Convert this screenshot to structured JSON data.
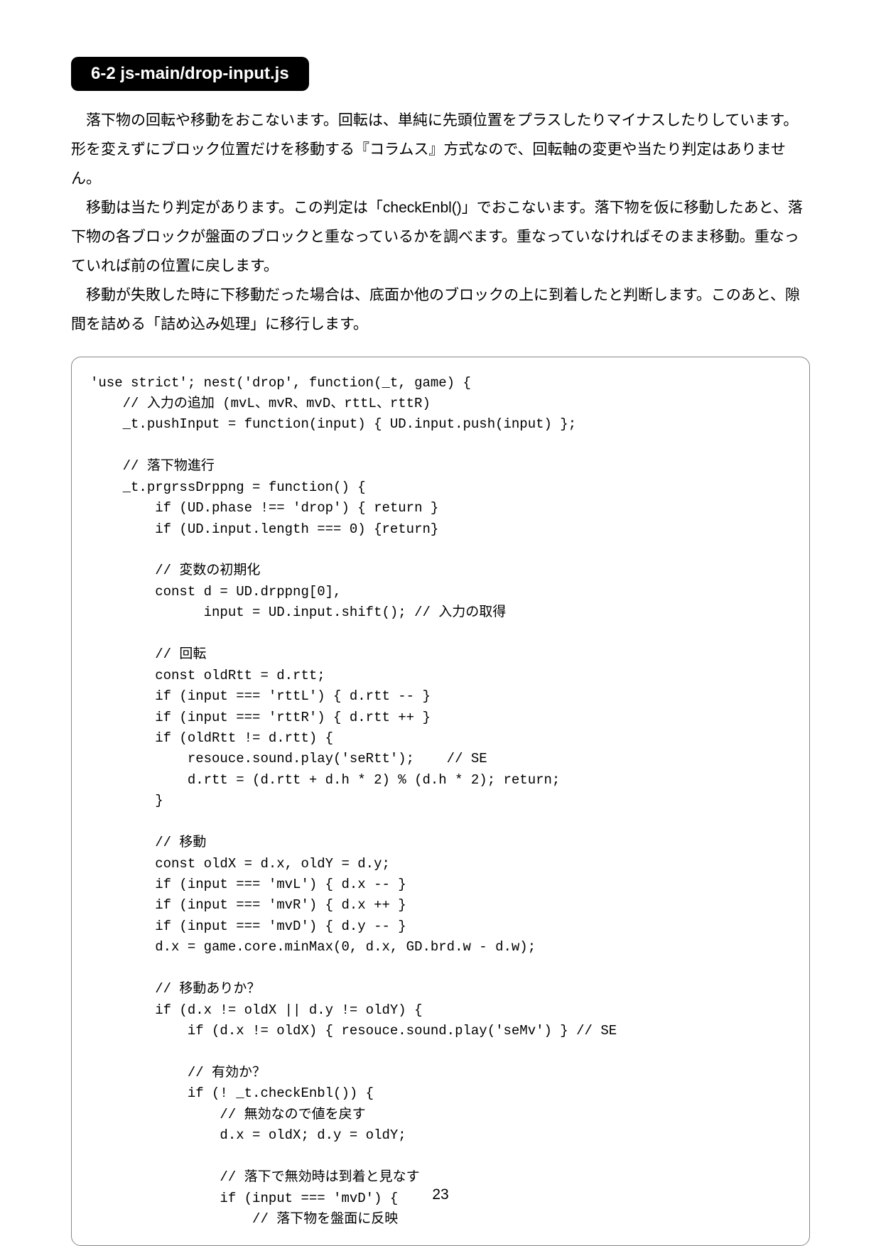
{
  "heading": "6-2  js-main/drop-input.js",
  "paragraphs": [
    "落下物の回転や移動をおこないます。回転は、単純に先頭位置をプラスしたりマイナスしたりしています。形を変えずにブロック位置だけを移動する『コラムス』方式なので、回転軸の変更や当たり判定はありません。",
    "移動は当たり判定があります。この判定は「checkEnbl()」でおこないます。落下物を仮に移動したあと、落下物の各ブロックが盤面のブロックと重なっているかを調べます。重なっていなければそのまま移動。重なっていれば前の位置に戻します。",
    "移動が失敗した時に下移動だった場合は、底面か他のブロックの上に到着したと判断します。このあと、隙間を詰める「詰め込み処理」に移行します。"
  ],
  "code": "'use strict'; nest('drop', function(_t, game) {\n    // 入力の追加 (mvL、mvR、mvD、rttL、rttR)\n    _t.pushInput = function(input) { UD.input.push(input) };\n\n    // 落下物進行\n    _t.prgrssDrppng = function() {\n        if (UD.phase !== 'drop') { return }\n        if (UD.input.length === 0) {return}\n\n        // 変数の初期化\n        const d = UD.drppng[0],\n              input = UD.input.shift(); // 入力の取得\n\n        // 回転\n        const oldRtt = d.rtt;\n        if (input === 'rttL') { d.rtt -- }\n        if (input === 'rttR') { d.rtt ++ }\n        if (oldRtt != d.rtt) {\n            resouce.sound.play('seRtt');    // SE\n            d.rtt = (d.rtt + d.h * 2) % (d.h * 2); return;\n        }\n\n        // 移動\n        const oldX = d.x, oldY = d.y;\n        if (input === 'mvL') { d.x -- }\n        if (input === 'mvR') { d.x ++ }\n        if (input === 'mvD') { d.y -- }\n        d.x = game.core.minMax(0, d.x, GD.brd.w - d.w);\n\n        // 移動ありか？\n        if (d.x != oldX || d.y != oldY) {\n            if (d.x != oldX) { resouce.sound.play('seMv') } // SE\n\n            // 有効か？\n            if (! _t.checkEnbl()) {\n                // 無効なので値を戻す\n                d.x = oldX; d.y = oldY;\n\n                // 落下で無効時は到着と見なす\n                if (input === 'mvD') {\n                    // 落下物を盤面に反映",
  "pageNumber": "23"
}
